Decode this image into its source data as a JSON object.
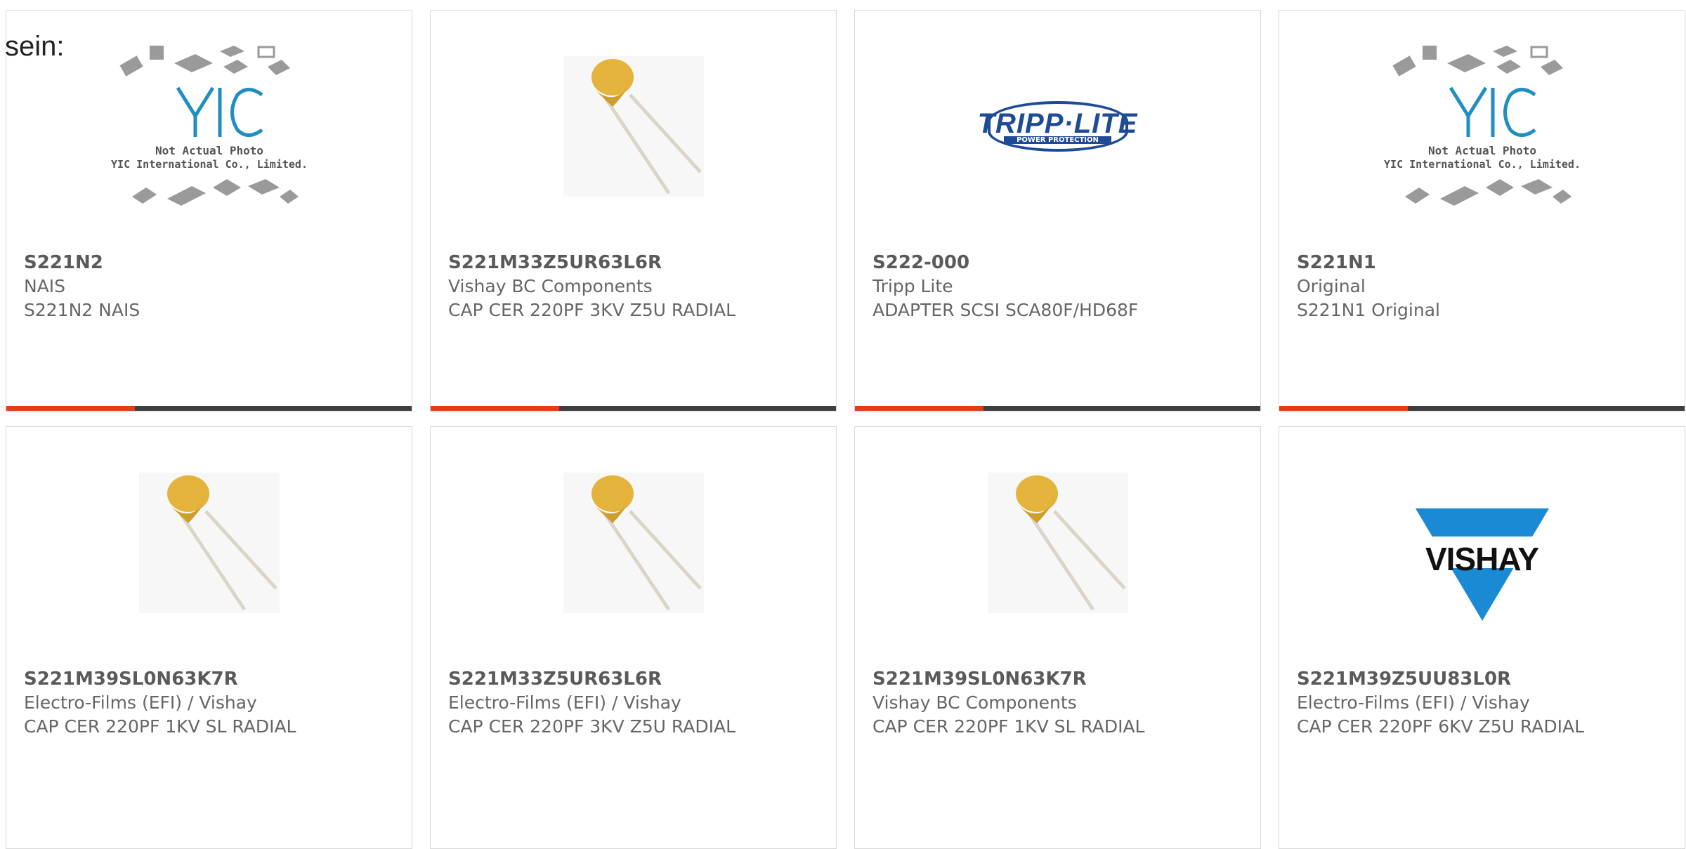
{
  "lead_text": "sein:",
  "accent_color": "#e63c12",
  "placeholder_text": {
    "line1": "Not Actual Photo",
    "line2": "YIC International Co., Limited.",
    "logo": "YIC"
  },
  "logos": {
    "tripp_main": "TRIPP·LITE",
    "tripp_sub": "POWER PROTECTION",
    "vishay": "VISHAY"
  },
  "products": [
    {
      "part": "S221N2",
      "manufacturer": "NAIS",
      "description": "S221N2 NAIS",
      "image": "yic-placeholder-image"
    },
    {
      "part": "S221M33Z5UR63L6R",
      "manufacturer": "Vishay BC Components",
      "description": "CAP CER 220PF 3KV Z5U RADIAL",
      "image": "ceramic-capacitor-image"
    },
    {
      "part": "S222-000",
      "manufacturer": "Tripp Lite",
      "description": "ADAPTER SCSI SCA80F/HD68F",
      "image": "tripp-lite-logo"
    },
    {
      "part": "S221N1",
      "manufacturer": "Original",
      "description": "S221N1 Original",
      "image": "yic-placeholder-image"
    },
    {
      "part": "S221M39SL0N63K7R",
      "manufacturer": "Electro-Films (EFI) / Vishay",
      "description": "CAP CER 220PF 1KV SL RADIAL",
      "image": "ceramic-capacitor-image"
    },
    {
      "part": "S221M33Z5UR63L6R",
      "manufacturer": "Electro-Films (EFI) / Vishay",
      "description": "CAP CER 220PF 3KV Z5U RADIAL",
      "image": "ceramic-capacitor-image"
    },
    {
      "part": "S221M39SL0N63K7R",
      "manufacturer": "Vishay BC Components",
      "description": "CAP CER 220PF 1KV SL RADIAL",
      "image": "ceramic-capacitor-image"
    },
    {
      "part": "S221M39Z5UU83L0R",
      "manufacturer": "Electro-Films (EFI) / Vishay",
      "description": "CAP CER 220PF 6KV Z5U RADIAL",
      "image": "vishay-logo"
    }
  ]
}
